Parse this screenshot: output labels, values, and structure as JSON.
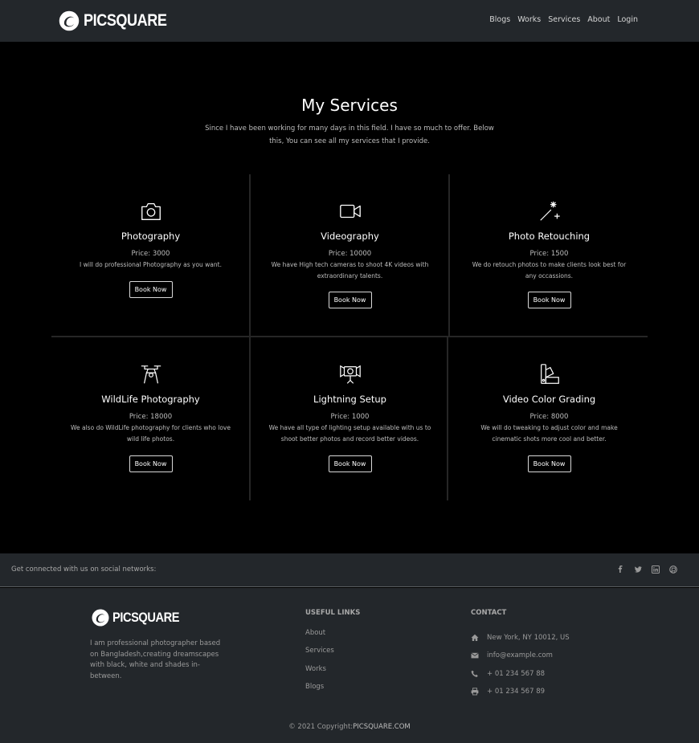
{
  "brand": {
    "name": "PICSQUARE",
    "logo_icon": "swirl-logo-icon"
  },
  "nav": {
    "items": [
      "Blogs",
      "Works",
      "Services",
      "About",
      "Login"
    ]
  },
  "services_section": {
    "title": "My Services",
    "subtitle": "Since I have been working for many days in this field. I have so much to offer. Below this, You can see all my services that I provide."
  },
  "services": [
    {
      "icon": "camera-icon",
      "title": "Photography",
      "price": "Price: 3000",
      "desc": "I will do professional Photography as you want.",
      "button": "Book Now"
    },
    {
      "icon": "video-camera-icon",
      "title": "Videography",
      "price": "Price: 10000",
      "desc": "We have High tech cameras to shoot 4K videos with extraordinary talents.",
      "button": "Book Now"
    },
    {
      "icon": "magic-wand-icon",
      "title": "Photo Retouching",
      "price": "Price: 1500",
      "desc": "We do retouch photos to make clients look best for any occassions.",
      "button": "Book Now"
    },
    {
      "icon": "drone-icon",
      "title": "WildLife Photography",
      "price": "Price: 18000",
      "desc": "We also do WildLife photography for clients who love wild life photos.",
      "button": "Book Now"
    },
    {
      "icon": "studio-light-icon",
      "title": "Lightning Setup",
      "price": "Price: 1000",
      "desc": "We have all type of lighting setup available with us to shoot better photos and record better videos.",
      "button": "Book Now"
    },
    {
      "icon": "color-palette-icon",
      "title": "Video Color Grading",
      "price": "Price: 8000",
      "desc": "We will do tweaking to adjust color and make cinematic shots more cool and better.",
      "button": "Book Now"
    }
  ],
  "social": {
    "text": "Get connected with us on social networks:",
    "icons": [
      "facebook-icon",
      "twitter-icon",
      "linkedin-icon",
      "github-icon"
    ]
  },
  "footer": {
    "about": "I am professional photographer based on Bangladesh,creating dreamscapes with black, white and shades in-between.",
    "links_heading": "USEFUL LINKS",
    "links": [
      "About",
      "Services",
      "Works",
      "Blogs"
    ],
    "contact_heading": "CONTACT",
    "contact": [
      {
        "icon": "home-icon",
        "text": "New York, NY 10012, US"
      },
      {
        "icon": "envelope-icon",
        "text": "info@example.com"
      },
      {
        "icon": "phone-icon",
        "text": "+ 01 234 567 88"
      },
      {
        "icon": "printer-icon",
        "text": "+ 01 234 567 89"
      }
    ],
    "copyright_prefix": "© 2021 Copyright:",
    "copyright_brand": "PICSQUARE.COM"
  },
  "colors": {
    "page_bg": "#000000",
    "bar_bg": "#23272b",
    "text_muted": "#9a9a9a",
    "divider": "#262626"
  }
}
